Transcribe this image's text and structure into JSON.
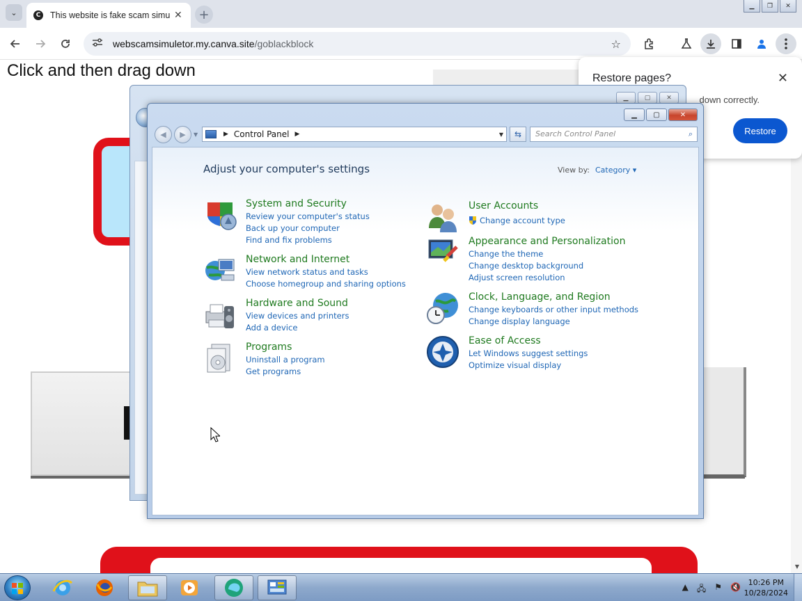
{
  "browser": {
    "tab_title": "This website is fake scam simu",
    "tab_close": "✕",
    "new_tab": "+",
    "url_host": "webscamsimuletor.my.canva.site",
    "url_path": "/goblackblock",
    "win_min": "▁",
    "win_restore": "❐",
    "win_close": "✕"
  },
  "page": {
    "heading": "Click and then drag down"
  },
  "restore_bubble": {
    "title": "Restore pages?",
    "body": "down correctly.",
    "button": "Restore",
    "close": "✕"
  },
  "control_panel": {
    "breadcrumb": "Control Panel",
    "search_placeholder": "Search Control Panel",
    "heading": "Adjust your computer's settings",
    "view_by_label": "View by:",
    "view_by_value": "Category ▾",
    "categories_left": [
      {
        "title": "System and Security",
        "links": [
          "Review your computer's status",
          "Back up your computer",
          "Find and fix problems"
        ],
        "icon": "shield-icon"
      },
      {
        "title": "Network and Internet",
        "links": [
          "View network status and tasks",
          "Choose homegroup and sharing options"
        ],
        "icon": "network-icon"
      },
      {
        "title": "Hardware and Sound",
        "links": [
          "View devices and printers",
          "Add a device"
        ],
        "icon": "printer-icon"
      },
      {
        "title": "Programs",
        "links": [
          "Uninstall a program",
          "Get programs"
        ],
        "icon": "programs-icon"
      }
    ],
    "categories_right": [
      {
        "title": "User Accounts",
        "links": [
          "Change account type"
        ],
        "icon": "users-icon"
      },
      {
        "title": "Appearance and Personalization",
        "links": [
          "Change the theme",
          "Change desktop background",
          "Adjust screen resolution"
        ],
        "icon": "monitor-icon"
      },
      {
        "title": "Clock, Language, and Region",
        "links": [
          "Change keyboards or other input methods",
          "Change display language"
        ],
        "icon": "globe-clock-icon"
      },
      {
        "title": "Ease of Access",
        "links": [
          "Let Windows suggest settings",
          "Optimize visual display"
        ],
        "icon": "ease-access-icon"
      }
    ]
  },
  "taskbar": {
    "time": "10:26 PM",
    "date": "10/28/2024"
  },
  "colors": {
    "link": "#1e66b5",
    "category_title": "#1f7a1f",
    "restore_button": "#0b57d0"
  }
}
